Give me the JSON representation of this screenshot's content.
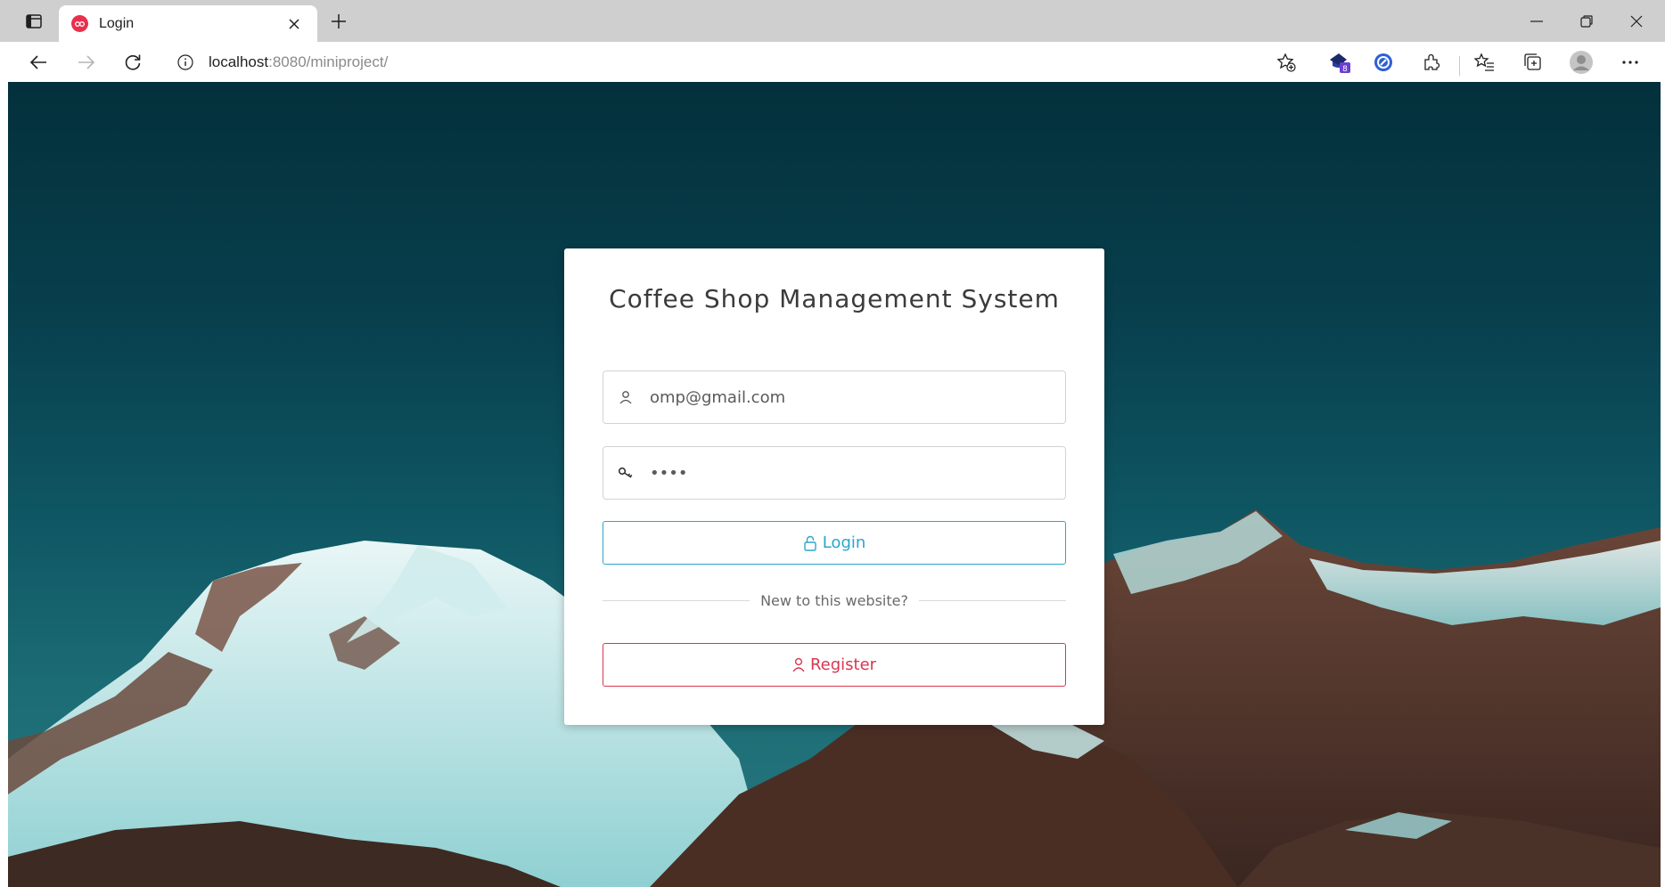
{
  "browser": {
    "tab_title": "Login",
    "url_host": "localhost",
    "url_path": ":8080/miniproject/",
    "extension_badge": "8"
  },
  "icons": {
    "tab_actions": "tab-actions-icon",
    "favicon": "favicon-icon",
    "tab_close": "close-icon",
    "new_tab": "plus-icon",
    "minimize": "minimize-icon",
    "restore": "restore-icon",
    "window_close": "close-icon",
    "back": "arrow-left-icon",
    "forward": "arrow-right-icon",
    "refresh": "refresh-icon",
    "site_info": "info-icon",
    "add_favorite": "star-plus-icon",
    "extension": "extension-icon",
    "puzzle": "puzzle-icon",
    "favorites": "favorites-icon",
    "collections": "collections-icon",
    "profile": "profile-icon",
    "more": "more-icon",
    "user": "user-icon",
    "key": "key-icon",
    "lock": "lock-icon"
  },
  "login": {
    "title": "Coffee Shop Management System",
    "email_value": "omp@gmail.com",
    "password_value": "••••",
    "login_label": "Login",
    "divider_text": "New to this website?",
    "register_label": "Register"
  },
  "colors": {
    "login_accent": "#2aa6cc",
    "register_accent": "#d8364f",
    "favicon": "#e8304e"
  }
}
